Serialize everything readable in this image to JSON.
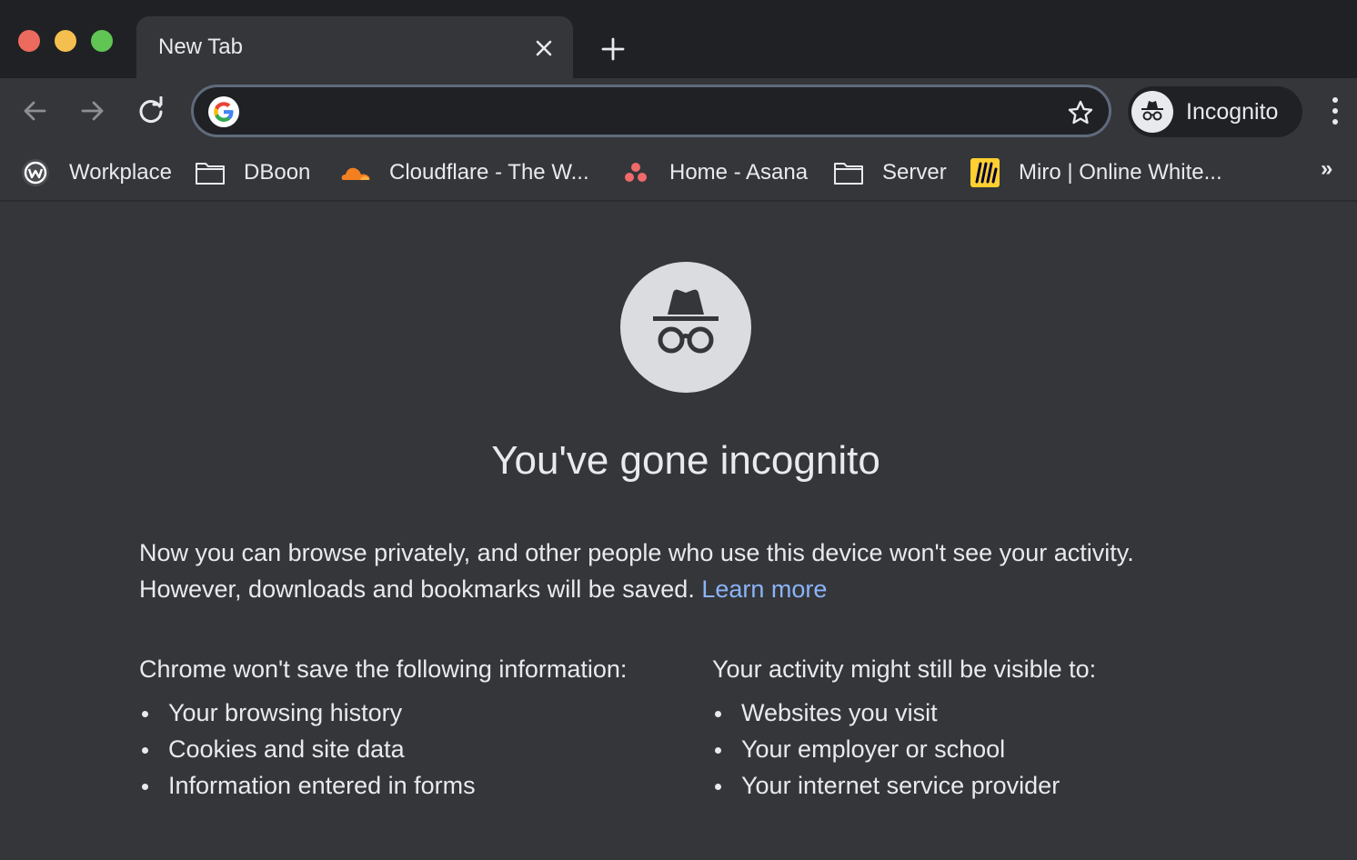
{
  "tab": {
    "title": "New Tab"
  },
  "omnibox": {
    "value": "",
    "placeholder": ""
  },
  "profile": {
    "label": "Incognito"
  },
  "bookmarks": [
    {
      "label": "Workplace",
      "icon": "workplace-icon"
    },
    {
      "label": "DBoon",
      "icon": "folder-icon"
    },
    {
      "label": "Cloudflare - The W...",
      "icon": "cloudflare-icon"
    },
    {
      "label": "Home - Asana",
      "icon": "asana-icon"
    },
    {
      "label": "Server",
      "icon": "folder-icon"
    },
    {
      "label": "Miro | Online White...",
      "icon": "miro-icon"
    }
  ],
  "bookmarks_overflow": "»",
  "page": {
    "headline": "You've gone incognito",
    "intro": "Now you can browse privately, and other people who use this device won't see your activity. However, downloads and bookmarks will be saved.",
    "learn_more": "Learn more",
    "left_heading": "Chrome won't save the following information:",
    "left_items": [
      "Your browsing history",
      "Cookies and site data",
      "Information entered in forms"
    ],
    "right_heading": "Your activity might still be visible to:",
    "right_items": [
      "Websites you visit",
      "Your employer or school",
      "Your internet service provider"
    ]
  },
  "colors": {
    "frame": "#202124",
    "toolbar": "#35363a",
    "text": "#e8eaed",
    "link": "#8ab4f8",
    "close": "#ed6a5e",
    "minimize": "#f5bf4f",
    "zoom": "#61c554"
  }
}
